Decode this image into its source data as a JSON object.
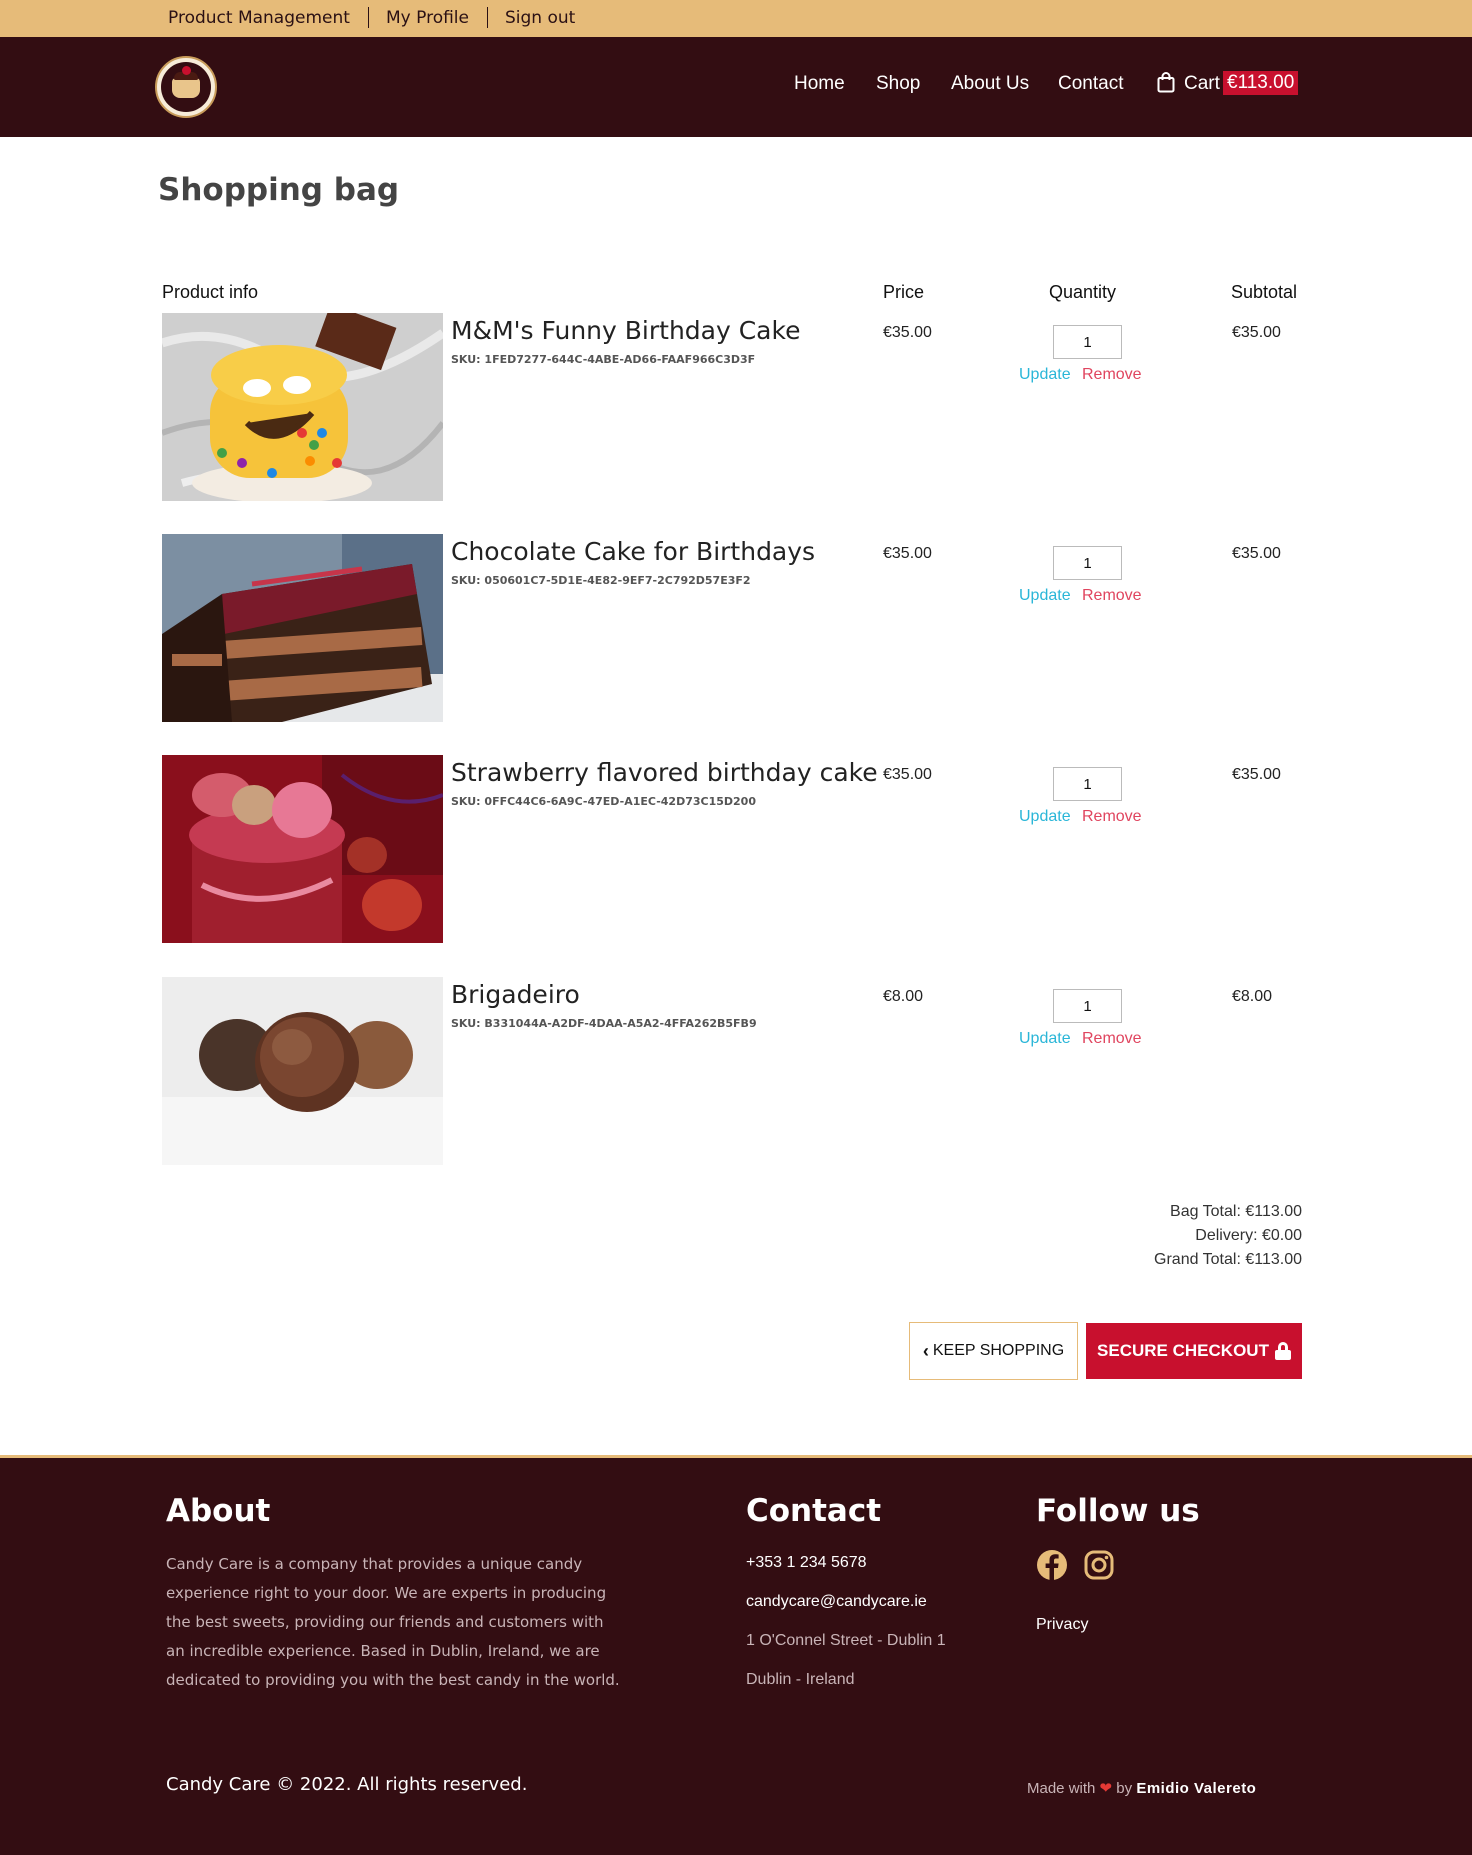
{
  "topbar": {
    "links": [
      "Product Management",
      "My Profile",
      "Sign out"
    ]
  },
  "header": {
    "logo_icon": "candy-care-logo",
    "nav": [
      "Home",
      "Shop",
      "About Us",
      "Contact"
    ],
    "cart_label": "Cart",
    "cart_total": "€113.00"
  },
  "page": {
    "title": "Shopping bag"
  },
  "table": {
    "headers": {
      "product": "Product info",
      "price": "Price",
      "quantity": "Quantity",
      "subtotal": "Subtotal"
    },
    "update_label": "Update",
    "remove_label": "Remove",
    "items": [
      {
        "name": "M&M's Funny Birthday Cake",
        "sku": "SKU: 1FED7277-644C-4ABE-AD66-FAAF966C3D3F",
        "price": "€35.00",
        "quantity": "1",
        "subtotal": "€35.00"
      },
      {
        "name": "Chocolate Cake for Birthdays",
        "sku": "SKU: 050601C7-5D1E-4E82-9EF7-2C792D57E3F2",
        "price": "€35.00",
        "quantity": "1",
        "subtotal": "€35.00"
      },
      {
        "name": "Strawberry flavored birthday cake",
        "sku": "SKU: 0FFC44C6-6A9C-47ED-A1EC-42D73C15D200",
        "price": "€35.00",
        "quantity": "1",
        "subtotal": "€35.00"
      },
      {
        "name": "Brigadeiro",
        "sku": "SKU: B331044A-A2DF-4DAA-A5A2-4FFA262B5FB9",
        "price": "€8.00",
        "quantity": "1",
        "subtotal": "€8.00"
      }
    ]
  },
  "totals": {
    "bag_total": "Bag Total: €113.00",
    "delivery": "Delivery: €0.00",
    "grand_total": "Grand Total: €113.00"
  },
  "actions": {
    "keep_shopping": "KEEP SHOPPING",
    "secure_checkout": "SECURE CHECKOUT"
  },
  "footer": {
    "about_title": "About",
    "about_text": "Candy Care is a company that provides a unique candy experience right to your door. We are experts in producing the best sweets, providing our friends and customers with an incredible experience. Based in Dublin, Ireland, we are dedicated to providing you with the best candy in the world.",
    "contact_title": "Contact",
    "phone": "+353 1 234 5678",
    "email": "candycare@candycare.ie",
    "address1": "1 O'Connel Street - Dublin 1",
    "address2": "Dublin - Ireland",
    "follow_title": "Follow us",
    "social_icons": [
      "facebook-icon",
      "instagram-icon"
    ],
    "privacy": "Privacy",
    "copyright": "Candy Care © 2022. All rights reserved.",
    "made_with": "Made with",
    "by": "by",
    "author": "Emidio Valereto"
  },
  "colors": {
    "brand_dark": "#330d12",
    "accent_gold": "#e6bb79",
    "accent_red": "#c8102e",
    "link_cyan": "#2ab6d8",
    "link_remove": "#e0455f"
  }
}
